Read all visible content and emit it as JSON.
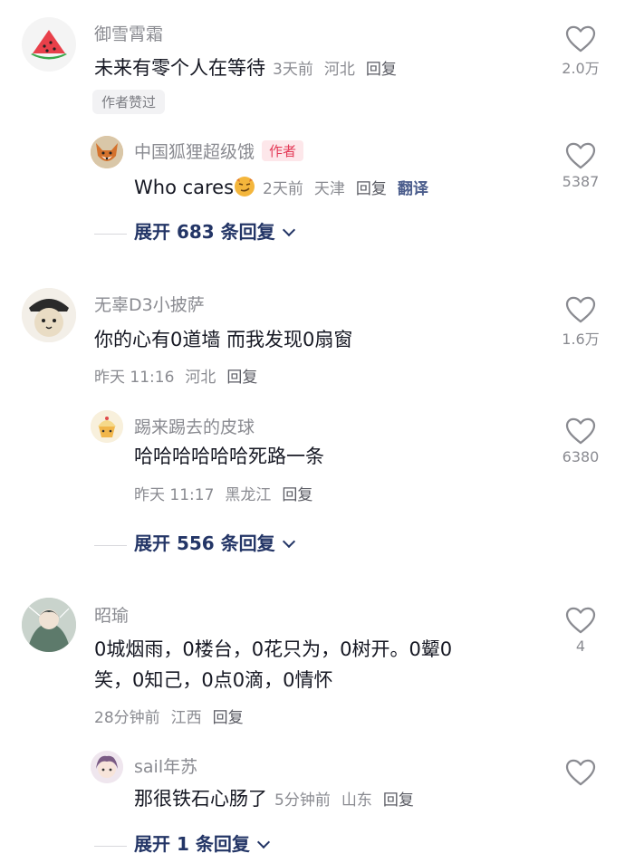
{
  "threads": [
    {
      "comment": {
        "username": "御雪霄霜",
        "text": "未来有零个人在等待",
        "time": "3天前",
        "location": "河北",
        "reply_label": "回复",
        "badge": "作者赞过",
        "likes": "2.0万",
        "avatar_icon": "watermelon-avatar"
      },
      "reply": {
        "username": "中国狐狸超级饿",
        "author_tag": "作者",
        "text": "Who cares",
        "emoji_icon": "smirk-emoji",
        "time": "2天前",
        "location": "天津",
        "reply_label": "回复",
        "translate_label": "翻译",
        "likes": "5387",
        "avatar_icon": "fox-avatar"
      },
      "expand_label": "展开 683 条回复"
    },
    {
      "comment": {
        "username": "无辜D3小披萨",
        "text": "你的心有0道墙 而我发现0扇窗",
        "time": "昨天 11:16",
        "location": "河北",
        "reply_label": "回复",
        "likes": "1.6万",
        "avatar_icon": "cat-hat-avatar"
      },
      "reply": {
        "username": "踢来踢去的皮球",
        "text": "哈哈哈哈哈哈死路一条",
        "time": "昨天 11:17",
        "location": "黑龙江",
        "reply_label": "回复",
        "likes": "6380",
        "avatar_icon": "cupcake-avatar"
      },
      "expand_label": "展开 556 条回复"
    },
    {
      "comment": {
        "username": "昭瑜",
        "text_line1": "0城烟雨，0楼台，0花只为，0树开。0颦0",
        "text_line2": "笑，0知己，0点0滴，0情怀",
        "time": "28分钟前",
        "location": "江西",
        "reply_label": "回复",
        "likes": "4",
        "avatar_icon": "anime-character-avatar"
      },
      "reply": {
        "username": "sail年苏",
        "text": "那很铁石心肠了",
        "time": "5分钟前",
        "location": "山东",
        "reply_label": "回复",
        "avatar_icon": "anime-girl-avatar"
      },
      "expand_label": "展开 1 条回复"
    }
  ],
  "colors": {
    "username": "#8a8b91",
    "text": "#161823",
    "expand": "#233566",
    "author_tag": "#e43a57"
  }
}
